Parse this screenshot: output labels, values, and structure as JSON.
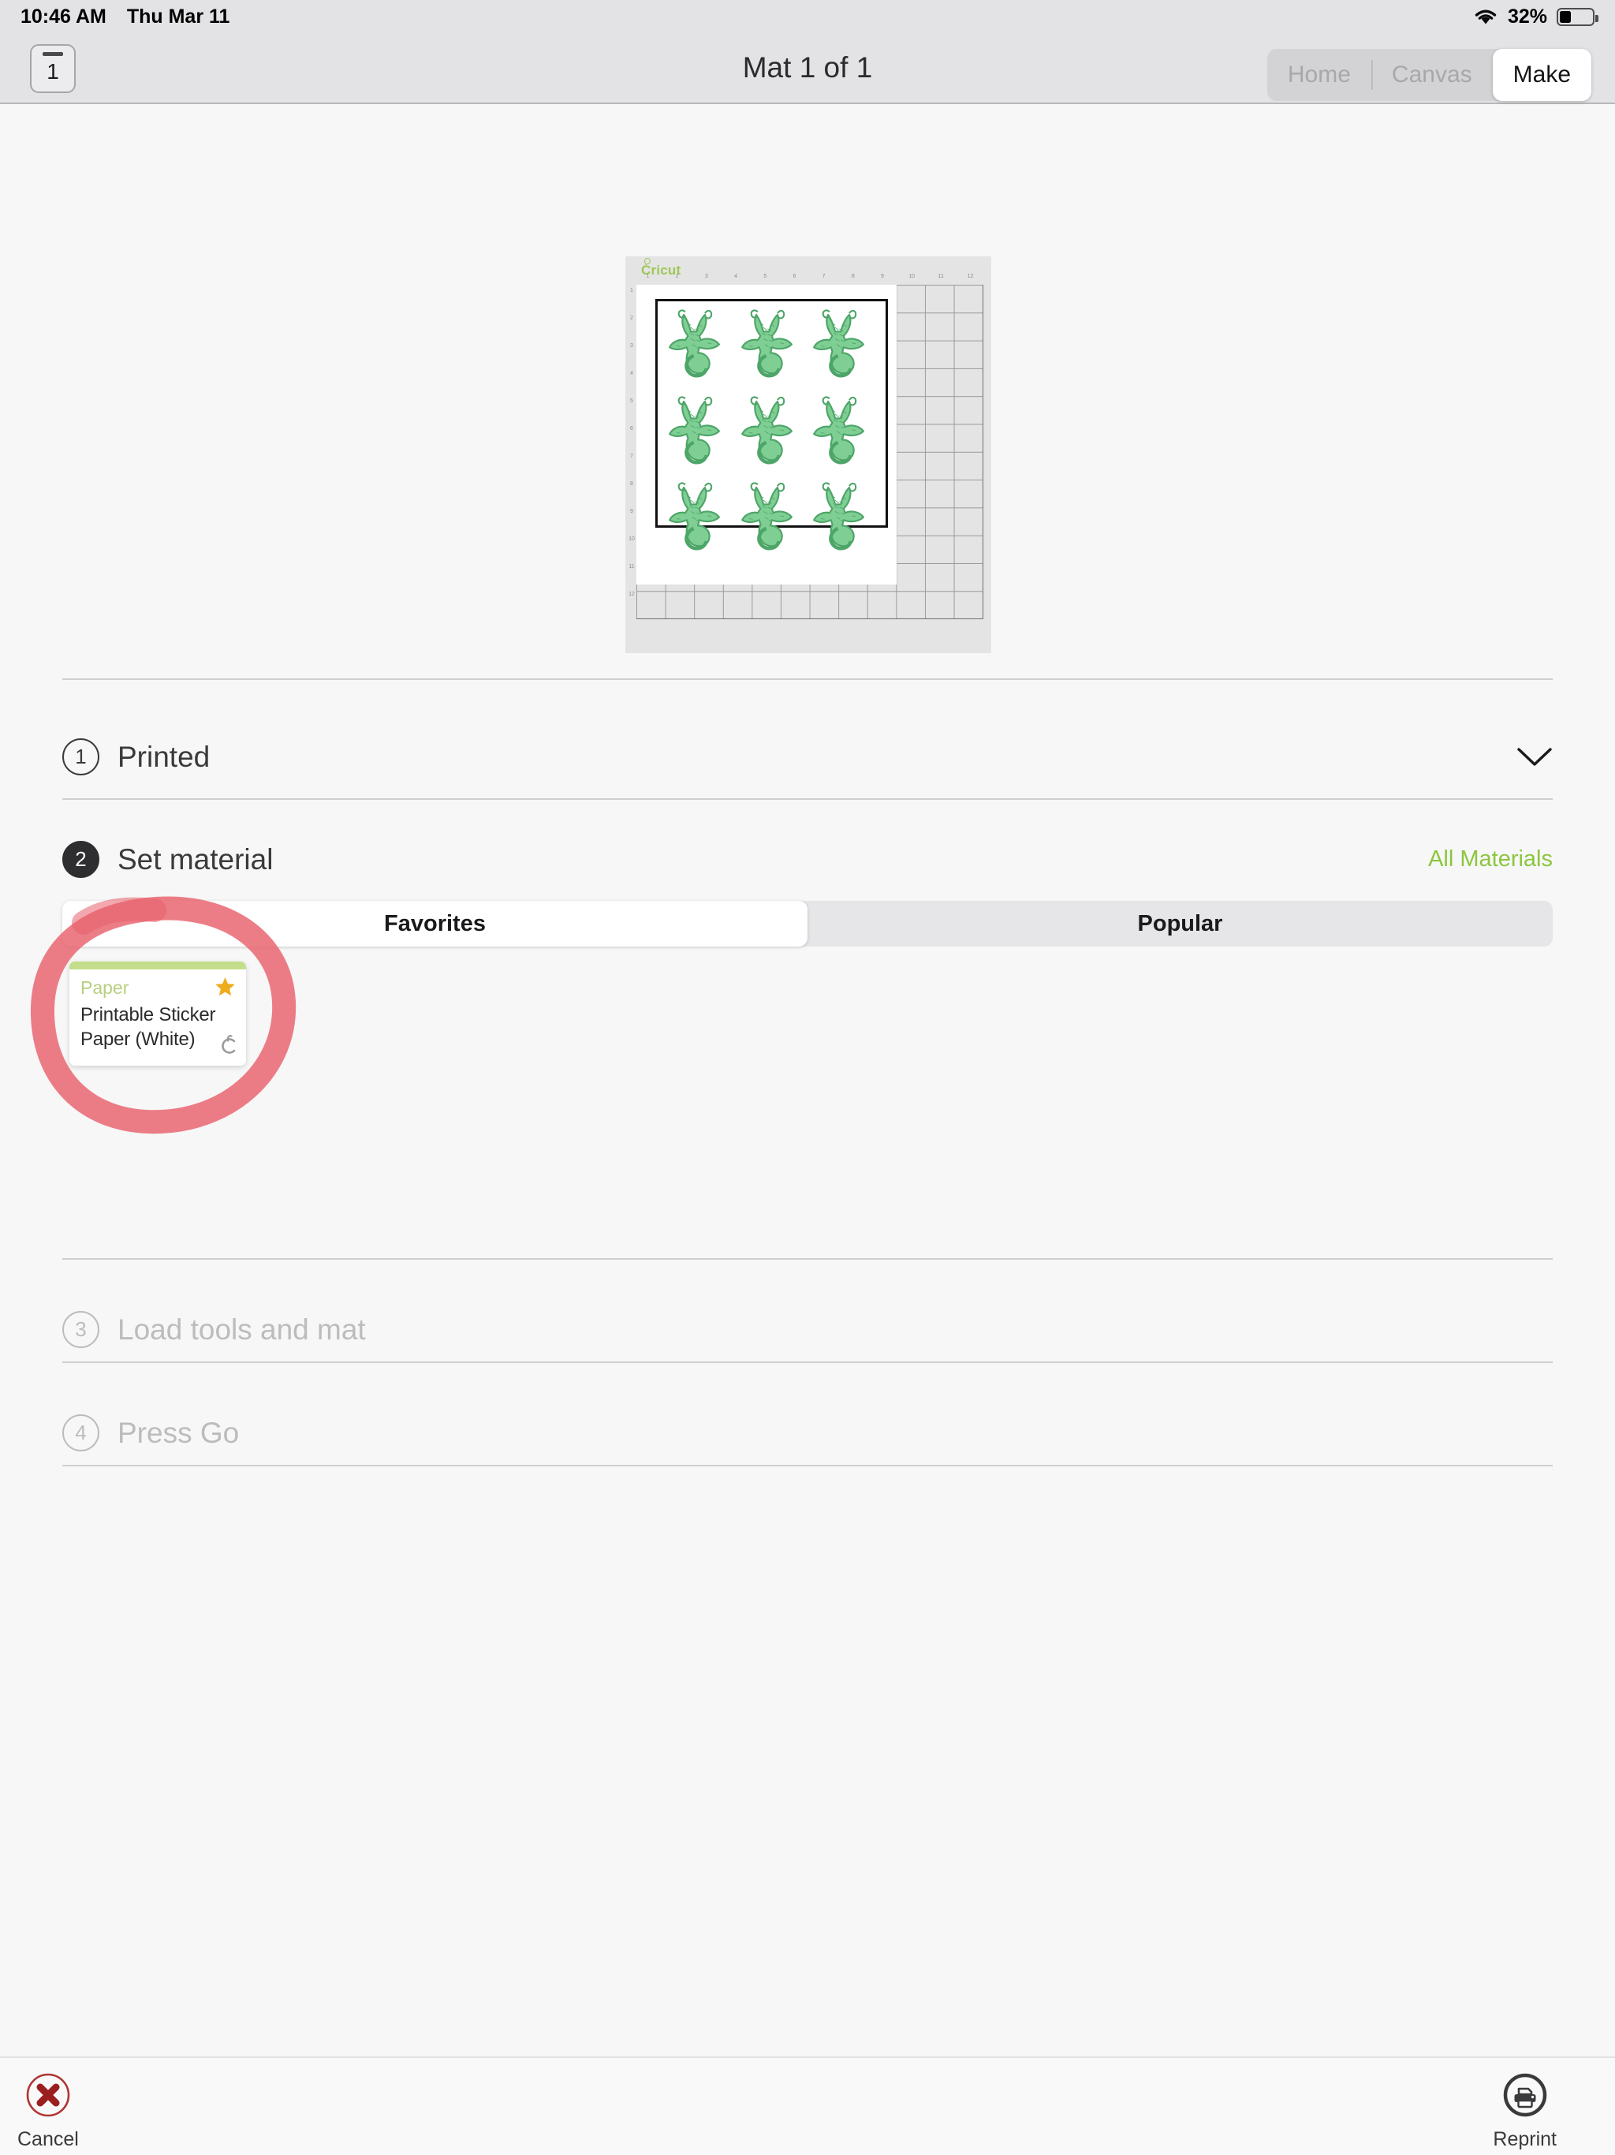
{
  "statusbar": {
    "time": "10:46 AM",
    "date": "Thu Mar 11",
    "battery_percent": "32%",
    "battery_level": 32,
    "wifi_icon": "wifi-icon",
    "battery_icon": "battery-icon"
  },
  "navbar": {
    "mat_thumb_label": "1",
    "title": "Mat 1 of 1",
    "segments": [
      {
        "label": "Home",
        "active": false
      },
      {
        "label": "Canvas",
        "active": false
      },
      {
        "label": "Make",
        "active": true
      }
    ]
  },
  "mat_preview": {
    "brand": "Cricut",
    "ruler_h": [
      "1",
      "2",
      "3",
      "4",
      "5",
      "6",
      "7",
      "8",
      "9",
      "10",
      "11",
      "12"
    ],
    "ruler_v": [
      "1",
      "2",
      "3",
      "4",
      "5",
      "6",
      "7",
      "8",
      "9",
      "10",
      "11",
      "12"
    ],
    "sticker_name": "sea-turtle-sticker",
    "sticker_rows": 3,
    "sticker_cols": 3,
    "sticker_count": 9,
    "sticker_color": "#4da567",
    "sticker_fill": "#7fcf95"
  },
  "steps": [
    {
      "number": "1",
      "label": "Printed",
      "state": "complete",
      "accessory": "chevron-down-icon"
    },
    {
      "number": "2",
      "label": "Set material",
      "state": "active",
      "accessory": "all-materials-link"
    },
    {
      "number": "3",
      "label": "Load tools and mat",
      "state": "disabled",
      "accessory": ""
    },
    {
      "number": "4",
      "label": "Press Go",
      "state": "disabled",
      "accessory": ""
    }
  ],
  "set_material": {
    "all_materials_label": "All Materials",
    "tabs": [
      {
        "label": "Favorites",
        "active": true
      },
      {
        "label": "Popular",
        "active": false
      }
    ],
    "cards": [
      {
        "category": "Paper",
        "name": "Printable Sticker Paper (White)",
        "favorited": true,
        "brand_mark": "C",
        "accent_color": "#c3dd8b",
        "category_color": "#b8cf7e",
        "star_color": "#eeab1c"
      }
    ]
  },
  "annotation": {
    "type": "hand-drawn-circle",
    "color": "#e8606b",
    "target": "material-card"
  },
  "bottombar": {
    "cancel_label": "Cancel",
    "cancel_icon": "cancel-x-circle-icon",
    "cancel_color": "#9b1e1e",
    "reprint_label": "Reprint",
    "reprint_icon": "printer-circle-icon",
    "reprint_color": "#3a3a3c"
  },
  "colors": {
    "accent_green": "#8cc63e",
    "background": "#f7f7f7",
    "chrome": "#e3e3e5"
  }
}
